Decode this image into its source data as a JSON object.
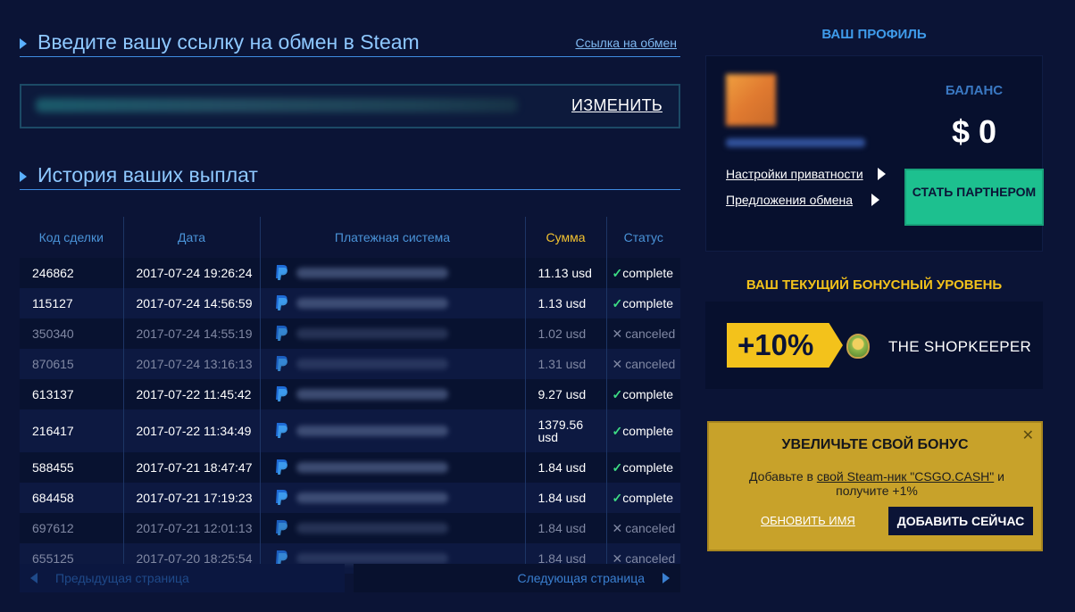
{
  "trade": {
    "section_title": "Введите вашу ссылку на обмен в Steam",
    "link_label": "Ссылка на обмен",
    "change_label": "ИЗМЕНИТЬ"
  },
  "history": {
    "section_title": "История ваших выплат",
    "columns": [
      "Код сделки",
      "Дата",
      "Платежная система",
      "Сумма",
      "Статус"
    ],
    "rows": [
      {
        "code": "246862",
        "date": "2017-07-24 19:26:24",
        "amount": "11.13 usd",
        "status": "complete"
      },
      {
        "code": "115127",
        "date": "2017-07-24 14:56:59",
        "amount": "1.13 usd",
        "status": "complete"
      },
      {
        "code": "350340",
        "date": "2017-07-24 14:55:19",
        "amount": "1.02 usd",
        "status": "canceled"
      },
      {
        "code": "870615",
        "date": "2017-07-24 13:16:13",
        "amount": "1.31 usd",
        "status": "canceled"
      },
      {
        "code": "613137",
        "date": "2017-07-22 11:45:42",
        "amount": "9.27 usd",
        "status": "complete"
      },
      {
        "code": "216417",
        "date": "2017-07-22 11:34:49",
        "amount": "1379.56 usd",
        "status": "complete"
      },
      {
        "code": "588455",
        "date": "2017-07-21 18:47:47",
        "amount": "1.84 usd",
        "status": "complete"
      },
      {
        "code": "684458",
        "date": "2017-07-21 17:19:23",
        "amount": "1.84 usd",
        "status": "complete"
      },
      {
        "code": "697612",
        "date": "2017-07-21 12:01:13",
        "amount": "1.84 usd",
        "status": "canceled"
      },
      {
        "code": "655125",
        "date": "2017-07-20 18:25:54",
        "amount": "1.84 usd",
        "status": "canceled"
      }
    ],
    "prev_label": "Предыдущая страница",
    "next_label": "Следующая страница"
  },
  "profile": {
    "title": "ВАШ ПРОФИЛЬ",
    "balance_label": "БАЛАНС",
    "balance_value": "$ 0",
    "privacy_link": "Настройки приватности",
    "offers_link": "Предложения обмена",
    "partner_button": "СТАТЬ ПАРТНЕРОМ"
  },
  "bonus": {
    "title": "ВАШ ТЕКУЩИЙ БОНУСНЫЙ УРОВЕНЬ",
    "percent": "+10%",
    "level_name": "THE SHOPKEEPER"
  },
  "promo": {
    "title": "УВЕЛИЧЬТЕ СВОЙ БОНУС",
    "text_before": "Добавьте в ",
    "text_link": "свой Steam-ник \"CSGO.CASH\"",
    "text_after": " и получите +1%",
    "update_label": "ОБНОВИТЬ ИМЯ",
    "add_label": "ДОБАВИТЬ СЕЙЧАС",
    "close": "✕"
  },
  "colors": {
    "background": "#0b1436",
    "accent_blue": "#5ab0ff",
    "complete_green": "#3ddc84",
    "gold": "#f3c21b",
    "partner_green": "#1dc08f"
  },
  "icons": {
    "payment": "paypal-icon",
    "complete": "check-icon",
    "canceled": "cross-icon"
  }
}
